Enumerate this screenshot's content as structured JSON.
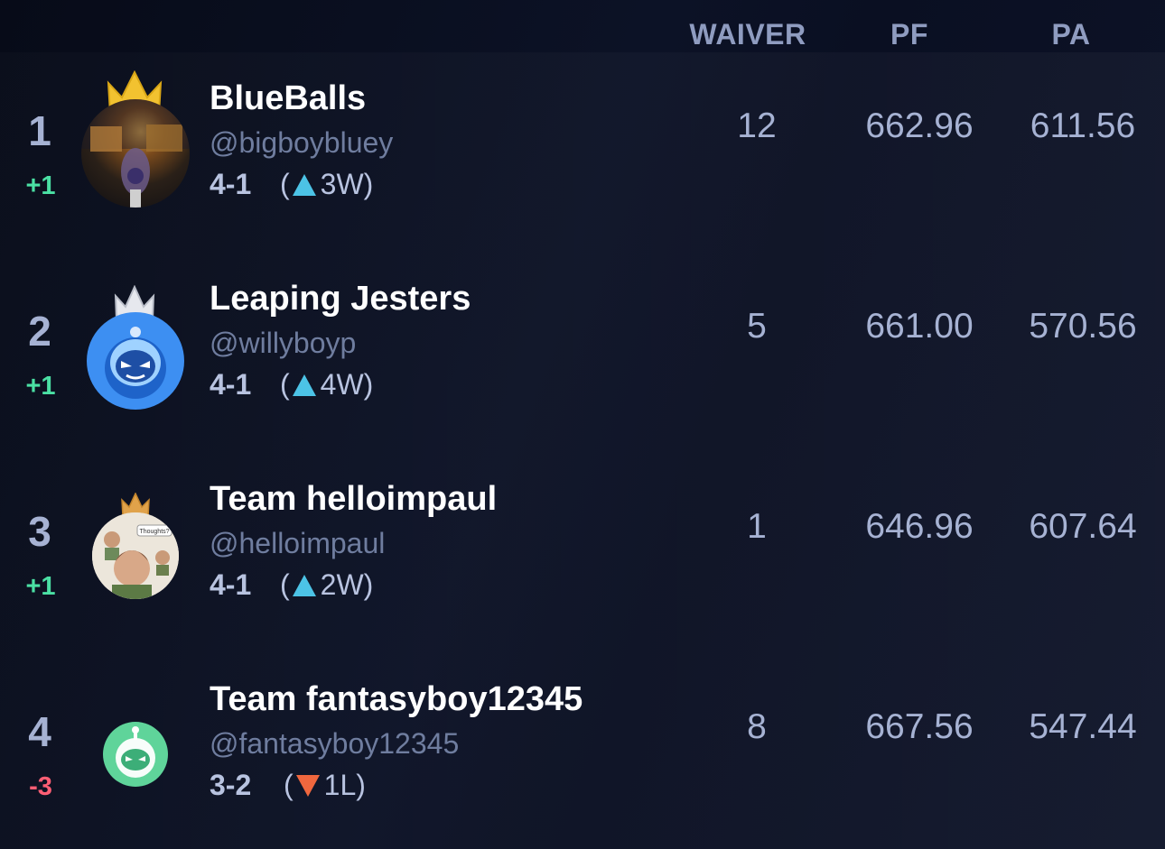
{
  "header": {
    "waiver": "WAIVER",
    "pf": "PF",
    "pa": "PA"
  },
  "teams": [
    {
      "rank": "1",
      "change": "+1",
      "change_dir": "up",
      "name": "BlueBalls",
      "handle": "@bigboybluey",
      "record": "4-1",
      "streak_open": "(",
      "streak": "3W)",
      "streak_dir": "up",
      "waiver": "12",
      "pf": "662.96",
      "pa": "611.56",
      "crown": "gold"
    },
    {
      "rank": "2",
      "change": "+1",
      "change_dir": "up",
      "name": "Leaping Jesters",
      "handle": "@willyboyp",
      "record": "4-1",
      "streak_open": "(",
      "streak": "4W)",
      "streak_dir": "up",
      "waiver": "5",
      "pf": "661.00",
      "pa": "570.56",
      "crown": "silver"
    },
    {
      "rank": "3",
      "change": "+1",
      "change_dir": "up",
      "name": "Team helloimpaul",
      "handle": "@helloimpaul",
      "record": "4-1",
      "streak_open": "(",
      "streak": "2W)",
      "streak_dir": "up",
      "waiver": "1",
      "pf": "646.96",
      "pa": "607.64",
      "crown": "bronze",
      "avatar_caption": "Thoughts?"
    },
    {
      "rank": "4",
      "change": "-3",
      "change_dir": "down",
      "name": "Team fantasyboy12345",
      "handle": "@fantasyboy12345",
      "record": "3-2",
      "streak_open": "(",
      "streak": "1L)",
      "streak_dir": "down",
      "waiver": "8",
      "pf": "667.56",
      "pa": "547.44",
      "crown": "none"
    }
  ],
  "colors": {
    "background": "#0b1020",
    "up": "#4be0a4",
    "down": "#ff5e74",
    "streak_up": "#4cc3e6",
    "streak_down": "#f0673e",
    "header_text": "#8f9cc0"
  },
  "icons": {
    "gold_crown": "crown-icon",
    "silver_crown": "crown-icon",
    "bronze_crown": "crown-icon",
    "up_triangle": "triangle-up-icon",
    "down_triangle": "triangle-down-icon"
  }
}
